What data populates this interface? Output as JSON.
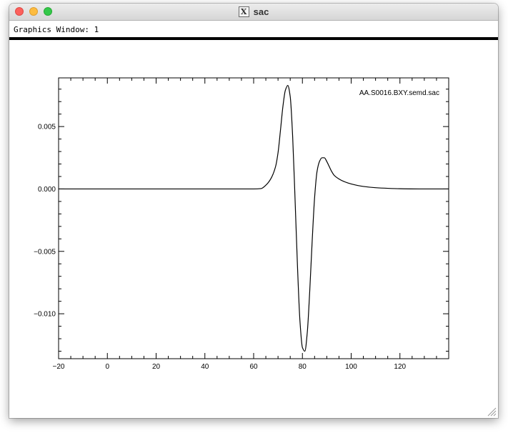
{
  "window": {
    "title": "sac",
    "graphics_label": "Graphics Window:  1"
  },
  "chart_data": {
    "type": "line",
    "title": "AA.S0016.BXY.semd.sac",
    "xlabel": "",
    "ylabel": "",
    "xlim": [
      -20,
      140
    ],
    "ylim": [
      -0.0136,
      0.0089
    ],
    "x_ticks": [
      -20,
      0,
      20,
      40,
      60,
      80,
      100,
      120
    ],
    "x_tick_labels": [
      "−20",
      "0",
      "20",
      "40",
      "60",
      "80",
      "100",
      "120"
    ],
    "y_ticks": [
      0.005,
      0.0,
      -0.005,
      -0.01
    ],
    "y_tick_labels": [
      "0.005",
      "0.000",
      "−0.005",
      "−0.010"
    ],
    "grid": false,
    "series": [
      {
        "x": [
          -20,
          0,
          20,
          40,
          60,
          63,
          65,
          67,
          69,
          70,
          71,
          72,
          73,
          74,
          75,
          76,
          77,
          78,
          79,
          80,
          81,
          82,
          83,
          84,
          85,
          86,
          87,
          88,
          89,
          90,
          91,
          92,
          93,
          95,
          97,
          100,
          105,
          110,
          115,
          120,
          130,
          140
        ],
        "y": [
          0,
          0,
          0,
          0,
          0,
          3e-05,
          0.0003,
          0.0008,
          0.0018,
          0.0029,
          0.0047,
          0.0066,
          0.0079,
          0.0083,
          0.0074,
          0.0042,
          -0.0009,
          -0.0063,
          -0.0106,
          -0.0127,
          -0.013,
          -0.0115,
          -0.0082,
          -0.0042,
          -0.0007,
          0.0014,
          0.0022,
          0.0025,
          0.0025,
          0.0022,
          0.0018,
          0.0014,
          0.0011,
          0.0008,
          0.0006,
          0.0004,
          0.0002,
          0.0001,
          5e-05,
          2e-05,
          0,
          0
        ],
        "color": "#000000"
      }
    ]
  }
}
